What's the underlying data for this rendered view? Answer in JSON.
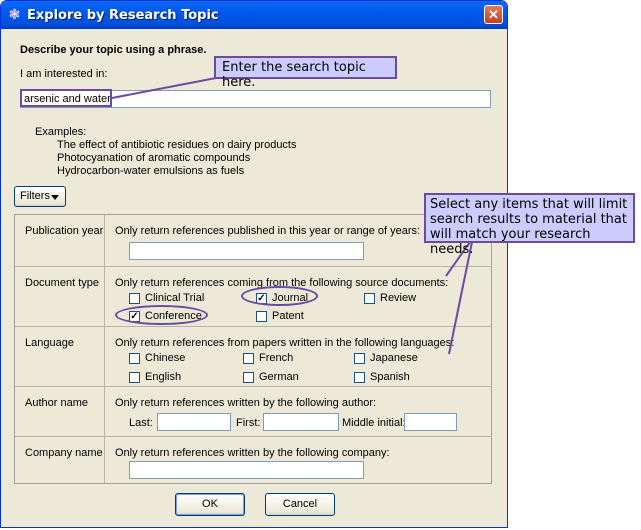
{
  "window": {
    "title": "Explore by Research Topic",
    "close_glyph": "✕"
  },
  "form": {
    "heading": "Describe your topic using a phrase.",
    "input_label": "I am interested in:",
    "input_value": "arsenic and water",
    "examples_label": "Examples:",
    "examples": [
      "The effect of antibiotic residues on dairy products",
      "Photocyanation of aromatic compounds",
      "Hydrocarbon-water emulsions as fuels"
    ]
  },
  "filters_button": {
    "label": "Filters"
  },
  "filters": {
    "publication_year": {
      "label": "Publication year",
      "desc": "Only return references published in this year or range of years:",
      "value": ""
    },
    "document_type": {
      "label": "Document type",
      "desc": "Only return references coming from the following source documents:",
      "options": [
        {
          "label": "Clinical Trial",
          "checked": false
        },
        {
          "label": "Journal",
          "checked": true
        },
        {
          "label": "Review",
          "checked": false
        },
        {
          "label": "Conference",
          "checked": true
        },
        {
          "label": "Patent",
          "checked": false
        }
      ]
    },
    "language": {
      "label": "Language",
      "desc": "Only return references from papers written in the following languages:",
      "options": [
        {
          "label": "Chinese",
          "checked": false
        },
        {
          "label": "French",
          "checked": false
        },
        {
          "label": "Japanese",
          "checked": false
        },
        {
          "label": "English",
          "checked": false
        },
        {
          "label": "German",
          "checked": false
        },
        {
          "label": "Spanish",
          "checked": false
        }
      ]
    },
    "author": {
      "label": "Author name",
      "desc": "Only return references written by the following author:",
      "last_label": "Last:",
      "first_label": "First:",
      "middle_label": "Middle initial:"
    },
    "company": {
      "label": "Company name",
      "desc": "Only return references written by the following company:",
      "value": ""
    }
  },
  "buttons": {
    "ok": "OK",
    "cancel": "Cancel"
  },
  "callouts": {
    "search": "Enter the search topic here.",
    "filters": "Select any items that will limit search results to material that will match your research needs."
  },
  "colors": {
    "callout_fill": "#ccccff",
    "callout_border": "#6b4aa0",
    "titlebar": "#0058ee"
  }
}
